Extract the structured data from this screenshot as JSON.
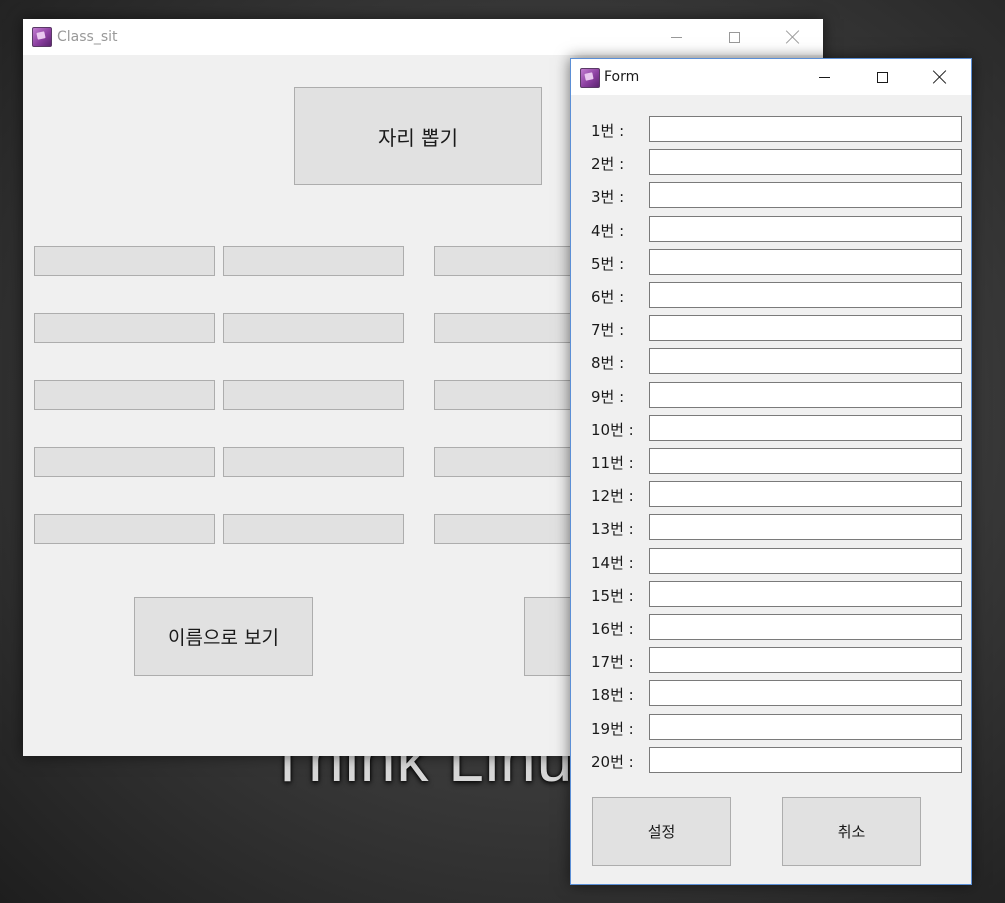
{
  "wallpaper": {
    "text": "Think Linux"
  },
  "main_window": {
    "title": "Class_sit",
    "draw_button": "자리 뽑기",
    "view_by_name_button": "이름으로 보기"
  },
  "form_window": {
    "title": "Form",
    "rows": [
      {
        "label": "1번 :",
        "value": ""
      },
      {
        "label": "2번 :",
        "value": ""
      },
      {
        "label": "3번 :",
        "value": ""
      },
      {
        "label": "4번 :",
        "value": ""
      },
      {
        "label": "5번 :",
        "value": ""
      },
      {
        "label": "6번 :",
        "value": ""
      },
      {
        "label": "7번 :",
        "value": ""
      },
      {
        "label": "8번 :",
        "value": ""
      },
      {
        "label": "9번 :",
        "value": ""
      },
      {
        "label": "10번 :",
        "value": ""
      },
      {
        "label": "11번 :",
        "value": ""
      },
      {
        "label": "12번 :",
        "value": ""
      },
      {
        "label": "13번 :",
        "value": ""
      },
      {
        "label": "14번 :",
        "value": ""
      },
      {
        "label": "15번 :",
        "value": ""
      },
      {
        "label": "16번 :",
        "value": ""
      },
      {
        "label": "17번 :",
        "value": ""
      },
      {
        "label": "18번 :",
        "value": ""
      },
      {
        "label": "19번 :",
        "value": ""
      },
      {
        "label": "20번 :",
        "value": ""
      }
    ],
    "set_button": "설정",
    "cancel_button": "취소"
  }
}
